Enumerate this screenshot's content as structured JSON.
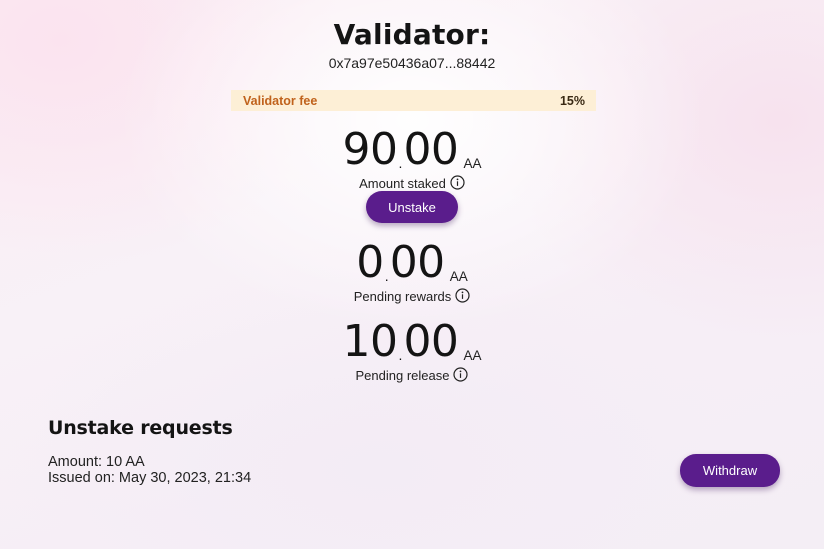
{
  "header": {
    "title": "Validator:",
    "address": "0x7a97e50436a07...88442"
  },
  "fee": {
    "label": "Validator fee",
    "value": "15%"
  },
  "staked": {
    "integer": "90",
    "decimal": "00",
    "unit": "AA",
    "label": "Amount staked",
    "info_icon": "info-circle-icon"
  },
  "unstake_button": {
    "label": "Unstake"
  },
  "pending_rewards": {
    "integer": "0",
    "decimal": "00",
    "unit": "AA",
    "label": "Pending rewards",
    "info_icon": "info-circle-icon"
  },
  "pending_release": {
    "integer": "10",
    "decimal": "00",
    "unit": "AA",
    "label": "Pending release",
    "info_icon": "info-circle-icon"
  },
  "unstake_requests": {
    "title": "Unstake requests",
    "items": [
      {
        "amount": "Amount: 10 AA",
        "issued": "Issued on: May 30, 2023, 21:34",
        "withdraw_label": "Withdraw"
      }
    ]
  },
  "colors": {
    "accent": "#5a1d8c",
    "fee_background": "#fdefd6",
    "fee_label": "#c0621c"
  }
}
